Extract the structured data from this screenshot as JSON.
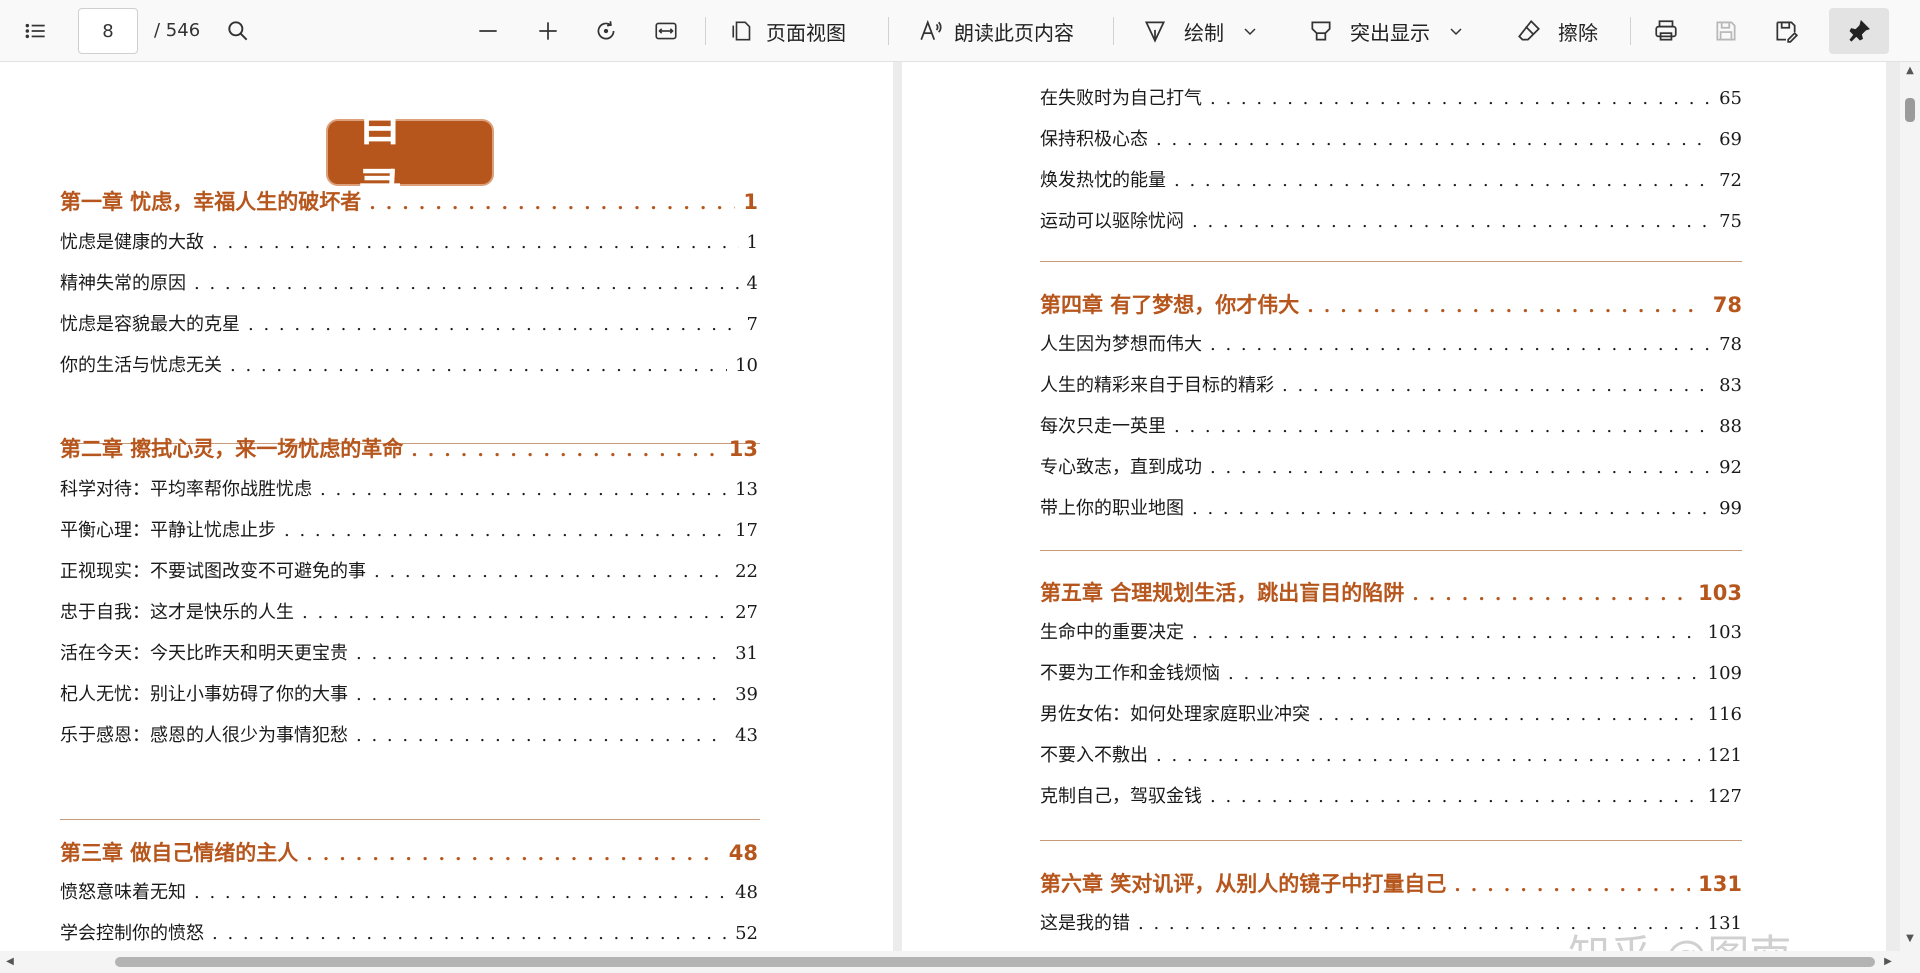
{
  "toolbar": {
    "current_page": "8",
    "total_pages": "/ 546",
    "page_view_label": "页面视图",
    "read_aloud_label": "朗读此页内容",
    "draw_label": "绘制",
    "highlight_label": "突出显示",
    "erase_label": "擦除"
  },
  "document": {
    "title": "目 录",
    "watermark": "知乎 @图南",
    "left_page": {
      "sections": [
        {
          "chapter": {
            "title": "第一章 忧虑，幸福人生的破坏者",
            "page": "1"
          },
          "items": [
            {
              "title": "忧虑是健康的大敌",
              "page": "1"
            },
            {
              "title": "精神失常的原因",
              "page": "4"
            },
            {
              "title": "忧虑是容貌最大的克星",
              "page": "7"
            },
            {
              "title": "你的生活与忧虑无关",
              "page": "10"
            }
          ]
        },
        {
          "chapter": {
            "title": "第二章 擦拭心灵，来一场忧虑的革命",
            "page": "13"
          },
          "items": [
            {
              "title": "科学对待：平均率帮你战胜忧虑",
              "page": "13"
            },
            {
              "title": "平衡心理：平静让忧虑止步",
              "page": "17"
            },
            {
              "title": "正视现实：不要试图改变不可避免的事",
              "page": "22"
            },
            {
              "title": "忠于自我：这才是快乐的人生",
              "page": "27"
            },
            {
              "title": "活在今天：今天比昨天和明天更宝贵",
              "page": "31"
            },
            {
              "title": "杞人无忧：别让小事妨碍了你的大事",
              "page": "39"
            },
            {
              "title": "乐于感恩：感恩的人很少为事情犯愁",
              "page": "43"
            }
          ]
        },
        {
          "chapter": {
            "title": "第三章 做自己情绪的主人",
            "page": "48"
          },
          "items": [
            {
              "title": "愤怒意味着无知",
              "page": "48"
            },
            {
              "title": "学会控制你的愤怒",
              "page": "52"
            }
          ]
        }
      ]
    },
    "right_page": {
      "sections": [
        {
          "items": [
            {
              "title": "在失败时为自己打气",
              "page": "65"
            },
            {
              "title": "保持积极心态",
              "page": "69"
            },
            {
              "title": "焕发热忱的能量",
              "page": "72"
            },
            {
              "title": "运动可以驱除忧闷",
              "page": "75"
            }
          ]
        },
        {
          "chapter": {
            "title": "第四章 有了梦想，你才伟大",
            "page": "78"
          },
          "items": [
            {
              "title": "人生因为梦想而伟大",
              "page": "78"
            },
            {
              "title": "人生的精彩来自于目标的精彩",
              "page": "83"
            },
            {
              "title": "每次只走一英里",
              "page": "88"
            },
            {
              "title": "专心致志，直到成功",
              "page": "92"
            },
            {
              "title": "带上你的职业地图",
              "page": "99"
            }
          ]
        },
        {
          "chapter": {
            "title": "第五章 合理规划生活，跳出盲目的陷阱",
            "page": "103"
          },
          "items": [
            {
              "title": "生命中的重要决定",
              "page": "103"
            },
            {
              "title": "不要为工作和金钱烦恼",
              "page": "109"
            },
            {
              "title": "男佐女佑：如何处理家庭职业冲突",
              "page": "116"
            },
            {
              "title": "不要入不敷出",
              "page": "121"
            },
            {
              "title": "克制自己，驾驭金钱",
              "page": "127"
            }
          ]
        },
        {
          "chapter": {
            "title": "第六章 笑对讥评，从别人的镜子中打量自己",
            "page": "131"
          },
          "items": [
            {
              "title": "这是我的错",
              "page": "131"
            }
          ]
        }
      ]
    }
  },
  "colors": {
    "accent": "#b6561c",
    "rule": "#c79a7a"
  }
}
